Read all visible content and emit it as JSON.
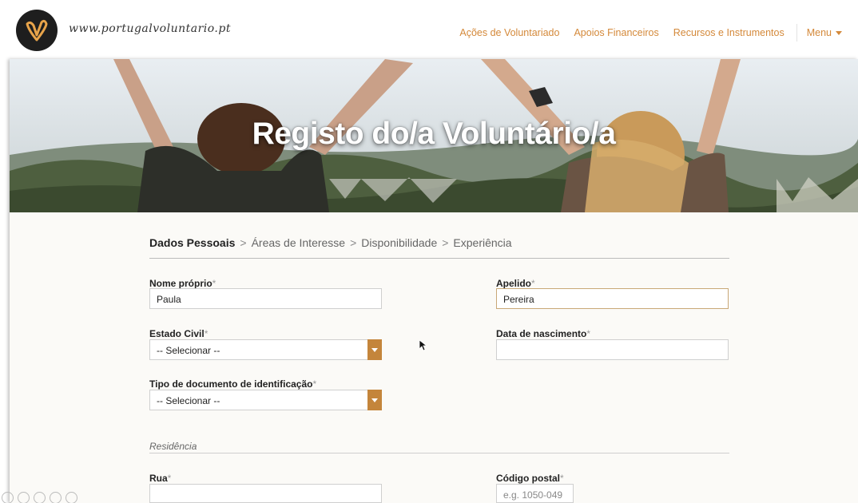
{
  "header": {
    "site_url": "www.portugalvoluntario.pt",
    "nav": [
      "Ações de Voluntariado",
      "Apoios Financeiros",
      "Recursos e Instrumentos"
    ],
    "menu_label": "Menu"
  },
  "hero": {
    "title": "Registo do/a Voluntário/a"
  },
  "steps": [
    "Dados Pessoais",
    "Áreas de Interesse",
    "Disponibilidade",
    "Experiência"
  ],
  "steps_separator": ">",
  "form": {
    "first_name": {
      "label": "Nome próprio",
      "required": "*",
      "value": "Paula"
    },
    "last_name": {
      "label": "Apelido",
      "required": "*",
      "value": "Pereira"
    },
    "civil_status": {
      "label": "Estado Civil",
      "required": "*",
      "value": "-- Selecionar --"
    },
    "birth_date": {
      "label": "Data de nascimento",
      "required": "*",
      "value": ""
    },
    "id_doc_type": {
      "label": "Tipo de documento de identificação",
      "required": "*",
      "value": "-- Selecionar --"
    },
    "residence_section": "Residência",
    "street": {
      "label": "Rua",
      "required": "*",
      "value": ""
    },
    "postal_code": {
      "label": "Código postal",
      "required": "*",
      "placeholder": "e.g. 1050-049"
    }
  },
  "colors": {
    "accent": "#c4853b",
    "nav_link": "#d4893a"
  }
}
